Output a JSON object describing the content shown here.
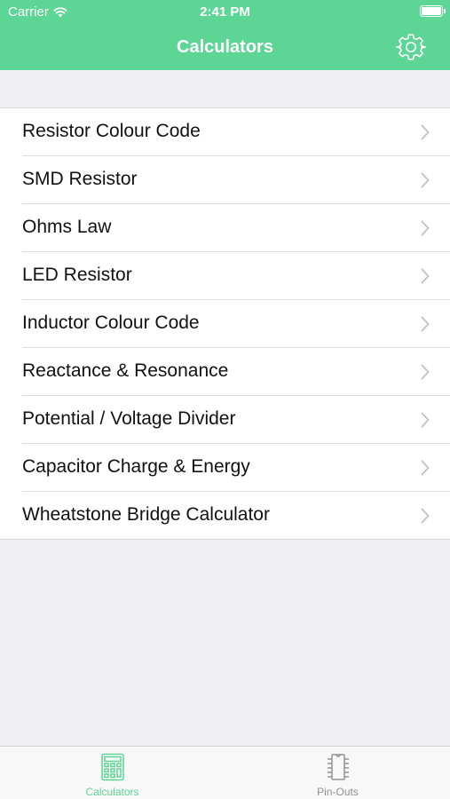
{
  "status_bar": {
    "carrier": "Carrier",
    "time": "2:41 PM"
  },
  "nav": {
    "title": "Calculators",
    "settings_icon": "gear-icon"
  },
  "calculators": [
    {
      "label": "Resistor Colour Code"
    },
    {
      "label": "SMD Resistor"
    },
    {
      "label": "Ohms Law"
    },
    {
      "label": "LED Resistor"
    },
    {
      "label": "Inductor Colour Code"
    },
    {
      "label": "Reactance & Resonance"
    },
    {
      "label": "Potential / Voltage Divider"
    },
    {
      "label": "Capacitor Charge & Energy"
    },
    {
      "label": "Wheatstone Bridge Calculator"
    }
  ],
  "tabs": [
    {
      "label": "Calculators",
      "icon": "calculator-icon",
      "active": true
    },
    {
      "label": "Pin-Outs",
      "icon": "chip-icon",
      "active": false
    }
  ],
  "colors": {
    "brand": "#5cd595",
    "tab_active": "#5cd595",
    "tab_inactive": "#929292"
  }
}
